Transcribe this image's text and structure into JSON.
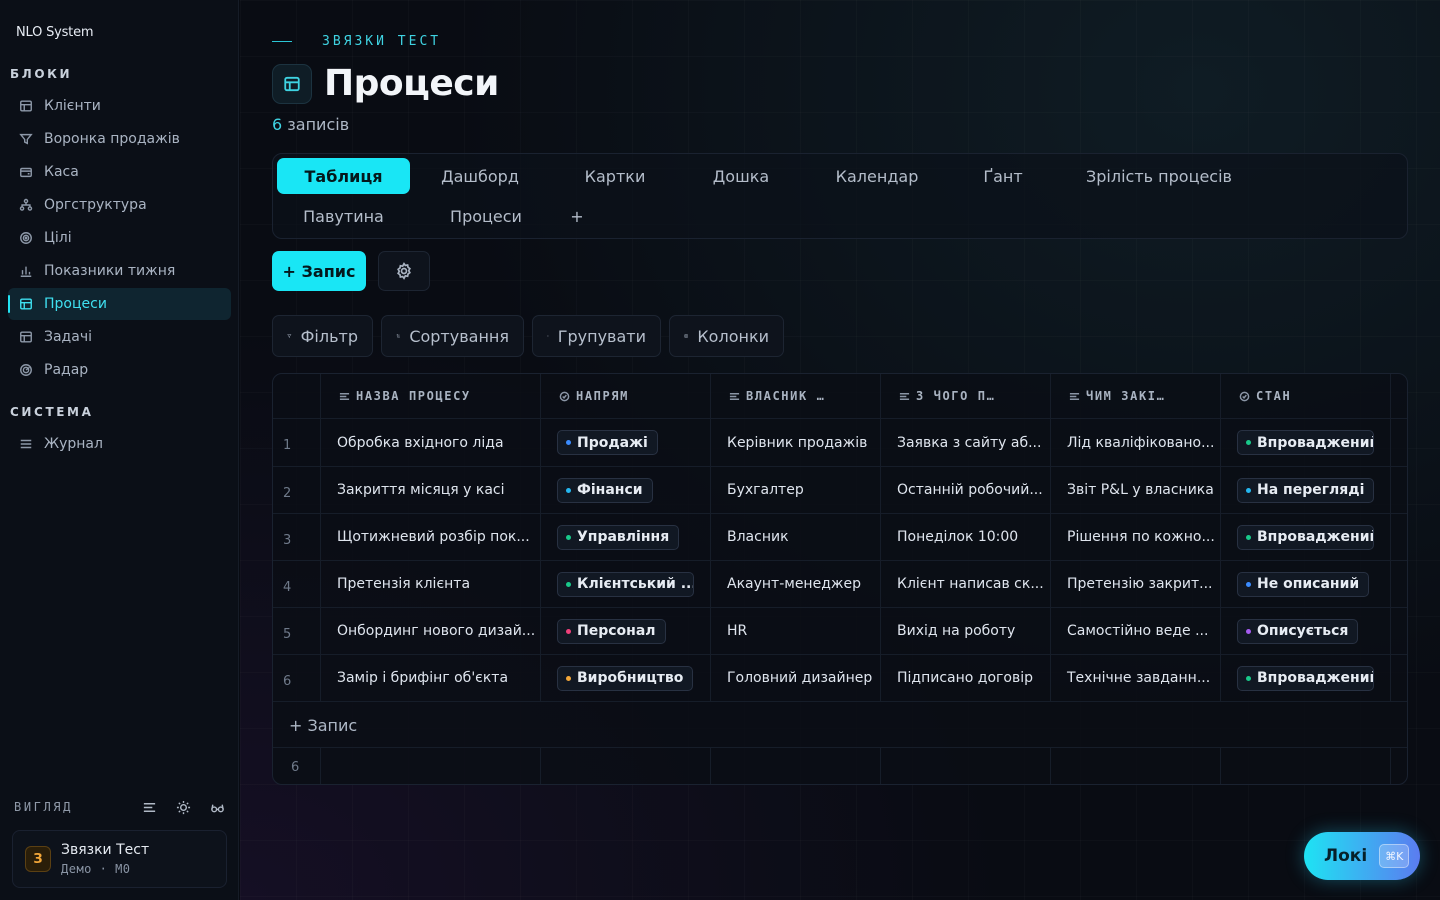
{
  "brand": "NLO System",
  "sidebar": {
    "blocks_title": "БЛОКИ",
    "blocks": [
      {
        "label": "Клієнти",
        "icon": "table-icon"
      },
      {
        "label": "Воронка продажів",
        "icon": "funnel-icon"
      },
      {
        "label": "Каса",
        "icon": "wallet-icon"
      },
      {
        "label": "Оргструктура",
        "icon": "org-icon"
      },
      {
        "label": "Цілі",
        "icon": "target-icon"
      },
      {
        "label": "Показники тижня",
        "icon": "bar-chart-icon"
      },
      {
        "label": "Процеси",
        "icon": "table-icon",
        "active": true
      },
      {
        "label": "Задачі",
        "icon": "table-icon"
      },
      {
        "label": "Радар",
        "icon": "radar-icon"
      }
    ],
    "system_title": "СИСТЕМА",
    "system": [
      {
        "label": "Журнал",
        "icon": "list-icon"
      }
    ],
    "view_label": "ВИГЛЯД",
    "user": {
      "initial": "З",
      "name": "Звязки Тест",
      "sub": "Демо · M0"
    }
  },
  "page": {
    "eyebrow": "ЗВЯЗКИ ТЕСТ",
    "title": "Процеси",
    "count_num": "6",
    "count_label": "записів"
  },
  "views": [
    "Таблиця",
    "Дашборд",
    "Картки",
    "Дошка",
    "Календар",
    "Ґант",
    "Зрілість процесів",
    "Павутина",
    "Процеси",
    "+"
  ],
  "actions": {
    "add_label": "+ Запис"
  },
  "toolbar": {
    "filter": "Фільтр",
    "sort": "Сортування",
    "group": "Групувати",
    "columns": "Колонки"
  },
  "table": {
    "headers": [
      "НАЗВА ПРОЦЕСУ",
      "НАПРЯМ",
      "ВЛАСНИК …",
      "З ЧОГО П…",
      "ЧИМ ЗАКІ…",
      "СТАН"
    ],
    "rows": [
      {
        "n": "1",
        "name": "Обробка вхідного ліда",
        "dir": "Продажі",
        "dir_color": "#3b8cff",
        "owner": "Керівник продажів",
        "from": "Заявка з сайту аб...",
        "end": "Лід кваліфіковано...",
        "state": "Впроваджений",
        "state_color": "#19c98a"
      },
      {
        "n": "2",
        "name": "Закриття місяця у касі",
        "dir": "Фінанси",
        "dir_color": "#25b7f0",
        "owner": "Бухгалтер",
        "from": "Останній робочий...",
        "end": "Звіт P&L у власника",
        "state": "На перегляді",
        "state_color": "#25b7f0"
      },
      {
        "n": "3",
        "name": "Щотижневий розбір пок...",
        "dir": "Управління",
        "dir_color": "#19c98a",
        "owner": "Власник",
        "from": "Понеділок 10:00",
        "end": "Рішення по кожно...",
        "state": "Впроваджений",
        "state_color": "#19c98a"
      },
      {
        "n": "4",
        "name": "Претензія клієнта",
        "dir": "Клієнтський ...",
        "dir_color": "#19c98a",
        "owner": "Акаунт-менеджер",
        "from": "Клієнт написав ск...",
        "end": "Претензію закрит...",
        "state": "Не описаний",
        "state_color": "#3b8cff"
      },
      {
        "n": "5",
        "name": "Онбординг нового дизай...",
        "dir": "Персонал",
        "dir_color": "#f0407a",
        "owner": "HR",
        "from": "Вихід на роботу",
        "end": "Самостійно веде ...",
        "state": "Описується",
        "state_color": "#a65cf0"
      },
      {
        "n": "6",
        "name": "Замір і брифінг об'єкта",
        "dir": "Виробництво",
        "dir_color": "#f3a739",
        "owner": "Головний дизайнер",
        "from": "Підписано договір",
        "end": "Технічне завданн...",
        "state": "Впроваджений",
        "state_color": "#19c98a"
      }
    ],
    "add_row_label": "+ Запис",
    "footer_count": "6"
  },
  "loki": {
    "label": "Локі",
    "shortcut": "⌘K"
  }
}
